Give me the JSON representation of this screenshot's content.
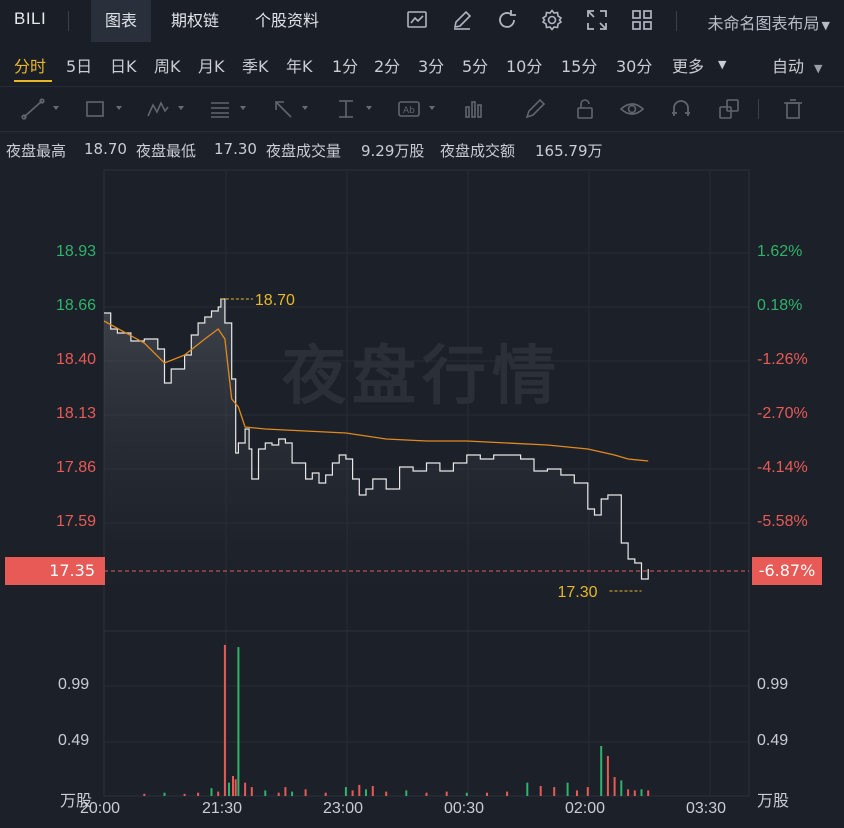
{
  "header": {
    "symbol": "BILI",
    "tabs": [
      "图表",
      "期权链",
      "个股资料"
    ],
    "layout_name": "未命名图表布局"
  },
  "toolbar_icons": [
    "chart-icon",
    "pen-icon",
    "refresh-icon",
    "gear-icon",
    "fullscreen-icon",
    "grid-icon"
  ],
  "periods": {
    "items": [
      "分时",
      "5日",
      "日K",
      "周K",
      "月K",
      "季K",
      "年K",
      "1分",
      "2分",
      "3分",
      "5分",
      "10分",
      "15分",
      "30分",
      "更多"
    ],
    "active": "分时",
    "right_select": "自动"
  },
  "drawing_tools": [
    "trend-line-icon",
    "rectangle-icon",
    "pattern-icon",
    "fib-icon",
    "arrow-icon",
    "measure-icon",
    "text-icon",
    "ruler-icon",
    "brush-icon",
    "lock-icon",
    "eye-icon",
    "magnet-icon",
    "layers-icon",
    "trash-icon"
  ],
  "info": {
    "high_label": "夜盘最高",
    "high": "18.70",
    "low_label": "夜盘最低",
    "low": "17.30",
    "vol_label": "夜盘成交量",
    "vol": "9.29万股",
    "amt_label": "夜盘成交额",
    "amt": "165.79万"
  },
  "watermark": "夜盘行情",
  "price_axis": {
    "labels": [
      "18.93",
      "18.66",
      "18.40",
      "18.13",
      "17.86",
      "17.59"
    ],
    "current": "17.35"
  },
  "pct_axis": {
    "labels": [
      "1.62%",
      "0.18%",
      "-1.26%",
      "-2.70%",
      "-4.14%",
      "-5.58%"
    ],
    "current": "-6.87%"
  },
  "annotations": {
    "high": "18.70",
    "low": "17.30"
  },
  "volume_axis": {
    "labels": [
      "0.99",
      "0.49"
    ],
    "unit": "万股"
  },
  "time_axis": [
    "20:00",
    "21:30",
    "23:00",
    "00:30",
    "02:00",
    "03:30"
  ],
  "colors": {
    "up": "#2fb36a",
    "down": "#e85a55",
    "accent": "#e8b828",
    "avg_line": "#e08a1e",
    "price_line": "#e8e8e8"
  },
  "chart_data": {
    "type": "line",
    "x_range": [
      "20:00",
      "04:00"
    ],
    "ylim": [
      17.2,
      19.2
    ],
    "series": [
      {
        "values": [
          [
            "20:00",
            18.63
          ],
          [
            "20:05",
            18.55
          ],
          [
            "20:10",
            18.53
          ],
          [
            "20:20",
            18.49
          ],
          [
            "20:30",
            18.5
          ],
          [
            "20:40",
            18.45
          ],
          [
            "20:45",
            18.28
          ],
          [
            "20:50",
            18.35
          ],
          [
            "21:00",
            18.42
          ],
          [
            "21:05",
            18.52
          ],
          [
            "21:10",
            18.58
          ],
          [
            "21:15",
            18.61
          ],
          [
            "21:20",
            18.64
          ],
          [
            "21:25",
            18.66
          ],
          [
            "21:27",
            18.7
          ],
          [
            "21:30",
            18.58
          ],
          [
            "21:32",
            18.58
          ],
          [
            "21:35",
            18.3
          ],
          [
            "21:38",
            17.93
          ],
          [
            "21:40",
            17.98
          ],
          [
            "21:45",
            18.05
          ],
          [
            "21:48",
            17.95
          ],
          [
            "21:50",
            17.8
          ],
          [
            "21:55",
            17.95
          ],
          [
            "22:00",
            17.98
          ],
          [
            "22:05",
            17.97
          ],
          [
            "22:10",
            18.0
          ],
          [
            "22:15",
            17.98
          ],
          [
            "22:20",
            17.88
          ],
          [
            "22:30",
            17.8
          ],
          [
            "22:35",
            17.83
          ],
          [
            "22:40",
            17.78
          ],
          [
            "22:45",
            17.82
          ],
          [
            "22:50",
            17.88
          ],
          [
            "22:55",
            17.92
          ],
          [
            "23:00",
            17.9
          ],
          [
            "23:05",
            17.8
          ],
          [
            "23:10",
            17.72
          ],
          [
            "23:15",
            17.75
          ],
          [
            "23:20",
            17.8
          ],
          [
            "23:30",
            17.75
          ],
          [
            "23:40",
            17.86
          ],
          [
            "23:50",
            17.84
          ],
          [
            "00:00",
            17.88
          ],
          [
            "00:10",
            17.84
          ],
          [
            "00:20",
            17.88
          ],
          [
            "00:30",
            17.92
          ],
          [
            "00:40",
            17.9
          ],
          [
            "00:50",
            17.92
          ],
          [
            "01:00",
            17.92
          ],
          [
            "01:10",
            17.9
          ],
          [
            "01:20",
            17.84
          ],
          [
            "01:30",
            17.85
          ],
          [
            "01:40",
            17.82
          ],
          [
            "01:50",
            17.78
          ],
          [
            "02:00",
            17.65
          ],
          [
            "02:05",
            17.62
          ],
          [
            "02:10",
            17.7
          ],
          [
            "02:15",
            17.72
          ],
          [
            "02:20",
            17.72
          ],
          [
            "02:25",
            17.48
          ],
          [
            "02:30",
            17.4
          ],
          [
            "02:35",
            17.38
          ],
          [
            "02:40",
            17.3
          ],
          [
            "02:45",
            17.35
          ]
        ]
      },
      {
        "values": [
          [
            "20:00",
            18.59
          ],
          [
            "20:30",
            18.48
          ],
          [
            "20:45",
            18.38
          ],
          [
            "21:00",
            18.42
          ],
          [
            "21:15",
            18.5
          ],
          [
            "21:25",
            18.55
          ],
          [
            "21:30",
            18.5
          ],
          [
            "21:35",
            18.2
          ],
          [
            "21:40",
            18.16
          ],
          [
            "21:45",
            18.06
          ],
          [
            "22:00",
            18.05
          ],
          [
            "22:30",
            18.04
          ],
          [
            "23:00",
            18.03
          ],
          [
            "23:30",
            18.0
          ],
          [
            "00:00",
            17.99
          ],
          [
            "00:30",
            17.99
          ],
          [
            "01:00",
            17.98
          ],
          [
            "01:30",
            17.97
          ],
          [
            "02:00",
            17.95
          ],
          [
            "02:20",
            17.92
          ],
          [
            "02:30",
            17.9
          ],
          [
            "02:45",
            17.89
          ]
        ]
      }
    ],
    "volume": {
      "type": "bar",
      "ylim": [
        0,
        1.5
      ],
      "bars": [
        [
          "20:30",
          0.02
        ],
        [
          "20:45",
          0.03
        ],
        [
          "21:00",
          0.02
        ],
        [
          "21:10",
          0.03
        ],
        [
          "21:20",
          0.07
        ],
        [
          "21:25",
          0.04
        ],
        [
          "21:30",
          1.36
        ],
        [
          "21:33",
          0.12
        ],
        [
          "21:36",
          0.18
        ],
        [
          "21:38",
          0.15
        ],
        [
          "21:40",
          1.34
        ],
        [
          "21:45",
          0.12
        ],
        [
          "21:50",
          0.08
        ],
        [
          "22:00",
          0.05
        ],
        [
          "22:10",
          0.03
        ],
        [
          "22:15",
          0.08
        ],
        [
          "22:20",
          0.04
        ],
        [
          "22:30",
          0.06
        ],
        [
          "22:45",
          0.03
        ],
        [
          "23:00",
          0.08
        ],
        [
          "23:05",
          0.05
        ],
        [
          "23:10",
          0.1
        ],
        [
          "23:15",
          0.06
        ],
        [
          "23:20",
          0.09
        ],
        [
          "23:30",
          0.04
        ],
        [
          "23:45",
          0.05
        ],
        [
          "00:00",
          0.03
        ],
        [
          "00:15",
          0.04
        ],
        [
          "00:30",
          0.03
        ],
        [
          "00:45",
          0.03
        ],
        [
          "01:00",
          0.04
        ],
        [
          "01:15",
          0.12
        ],
        [
          "01:25",
          0.09
        ],
        [
          "01:35",
          0.08
        ],
        [
          "01:45",
          0.12
        ],
        [
          "01:52",
          0.05
        ],
        [
          "02:00",
          0.08
        ],
        [
          "02:10",
          0.45
        ],
        [
          "02:15",
          0.36
        ],
        [
          "02:20",
          0.17
        ],
        [
          "02:25",
          0.14
        ],
        [
          "02:30",
          0.06
        ],
        [
          "02:35",
          0.05
        ],
        [
          "02:40",
          0.06
        ],
        [
          "02:45",
          0.05
        ]
      ]
    }
  }
}
